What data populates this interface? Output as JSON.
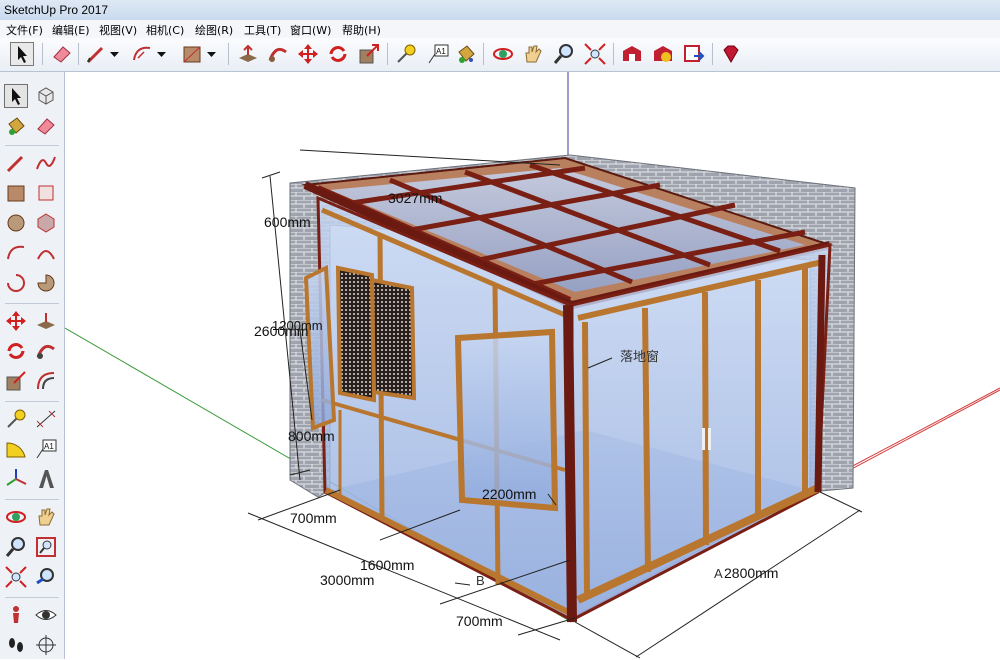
{
  "window": {
    "title": "SketchUp Pro 2017"
  },
  "menu": [
    "文件(F)",
    "编辑(E)",
    "视图(V)",
    "相机(C)",
    "绘图(R)",
    "工具(T)",
    "窗口(W)",
    "帮助(H)"
  ],
  "top_toolbar": [
    "select",
    "eraser",
    "line",
    "line-dropdown",
    "arc",
    "arc-dropdown",
    "rectangle",
    "rectangle-dropdown",
    "push-pull",
    "follow-me",
    "move",
    "rotate",
    "scale",
    "tape-measure",
    "text",
    "paint-bucket",
    "orbit",
    "pan",
    "zoom",
    "zoom-extents",
    "3d-warehouse",
    "extension-warehouse",
    "layout-send",
    "extension-manager"
  ],
  "left_toolbar": [
    "select",
    "make-component",
    "paint-bucket",
    "eraser",
    "line",
    "freehand",
    "rectangle",
    "rotated-rectangle",
    "circle",
    "polygon",
    "arc",
    "two-point-arc",
    "three-point-arc",
    "pie",
    "move",
    "push-pull",
    "rotate",
    "follow-me",
    "scale",
    "offset",
    "tape-measure",
    "dimension",
    "protractor",
    "text",
    "axes",
    "3d-text",
    "orbit",
    "pan",
    "zoom",
    "zoom-window",
    "zoom-extents",
    "previous-view",
    "position-camera",
    "look-around",
    "walk",
    "section-plane"
  ],
  "model": {
    "dimensions": {
      "roof_depth": "3027mm",
      "roof_slope_height": "600mm",
      "total_height": "2600mm",
      "window_height": "1200mm",
      "sill_height": "800mm",
      "left_window_width": "700mm",
      "door_width": "1600mm",
      "side_length": "3000mm",
      "right_window_width": "700mm",
      "door_height": "2200mm",
      "front_length": "2800mm"
    },
    "labels": {
      "floor_window": "落地窗",
      "side_b": "B",
      "side_a": "A"
    }
  },
  "colors": {
    "frame": "#7a1f14",
    "wood": "#b8762f",
    "glass": "#a9bfe6",
    "brick": "#9aa0aa",
    "axis_red": "#d64040",
    "axis_green": "#3a9a3a",
    "axis_blue": "#4040b0"
  }
}
